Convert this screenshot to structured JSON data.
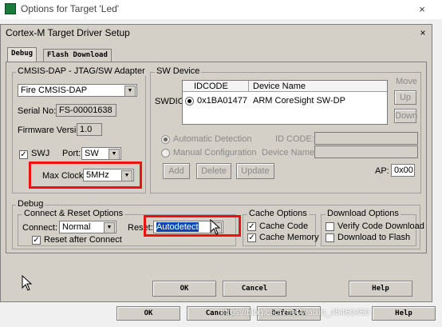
{
  "outer": {
    "title": "Options for Target 'Led'",
    "close_icon": "×",
    "buttons": [
      "OK",
      "Cancel",
      "Defaults",
      "Help"
    ],
    "watermark": "https://blog.csdn.net/waixin_45460450"
  },
  "dialog": {
    "title": "Cortex-M Target Driver Setup",
    "close_icon": "×",
    "tabs": [
      "Debug",
      "Flash Download"
    ]
  },
  "adapter": {
    "group_label": "CMSIS-DAP - JTAG/SW Adapter",
    "device": "Fire CMSIS-DAP",
    "serial_label": "Serial No:",
    "serial": "FS-00001638",
    "firmware_label": "Firmware Version:",
    "firmware": "1.0",
    "swj_label": "SWJ",
    "swj_checked": "✓",
    "port_label": "Port:",
    "port": "SW",
    "maxclock_label": "Max Clock:",
    "maxclock": "5MHz"
  },
  "swdevice": {
    "group_label": "SW Device",
    "swdio_label": "SWDIO",
    "col_idcode": "IDCODE",
    "col_name": "Device Name",
    "row_idcode": "0x1BA01477",
    "row_name": "ARM CoreSight SW-DP",
    "move_label": "Move",
    "up": "Up",
    "down": "Down",
    "auto_detect": "Automatic Detection",
    "manual_config": "Manual Configuration",
    "id_code_label": "ID CODE:",
    "device_name_label": "Device Name:",
    "add": "Add",
    "delete": "Delete",
    "update": "Update",
    "ap_label": "AP:",
    "ap_value": "0x00"
  },
  "debug": {
    "group_label": "Debug",
    "connect_group": "Connect & Reset Options",
    "connect_label": "Connect:",
    "connect_value": "Normal",
    "reset_label": "Reset:",
    "reset_value": "Autodetect",
    "reset_after_connect": "Reset after Connect",
    "reset_after_checked": "✓",
    "cache_group": "Cache Options",
    "cache_code": "Cache Code",
    "cache_memory": "Cache Memory",
    "cache_code_checked": "✓",
    "cache_memory_checked": "✓",
    "download_group": "Download Options",
    "verify_code": "Verify Code Download",
    "download_flash": "Download to Flash"
  },
  "bottom": {
    "ok": "OK",
    "cancel": "Cancel",
    "help": "Help"
  },
  "colors": {
    "highlight_red": "#ee1111",
    "selection_blue": "#0a48b0"
  }
}
